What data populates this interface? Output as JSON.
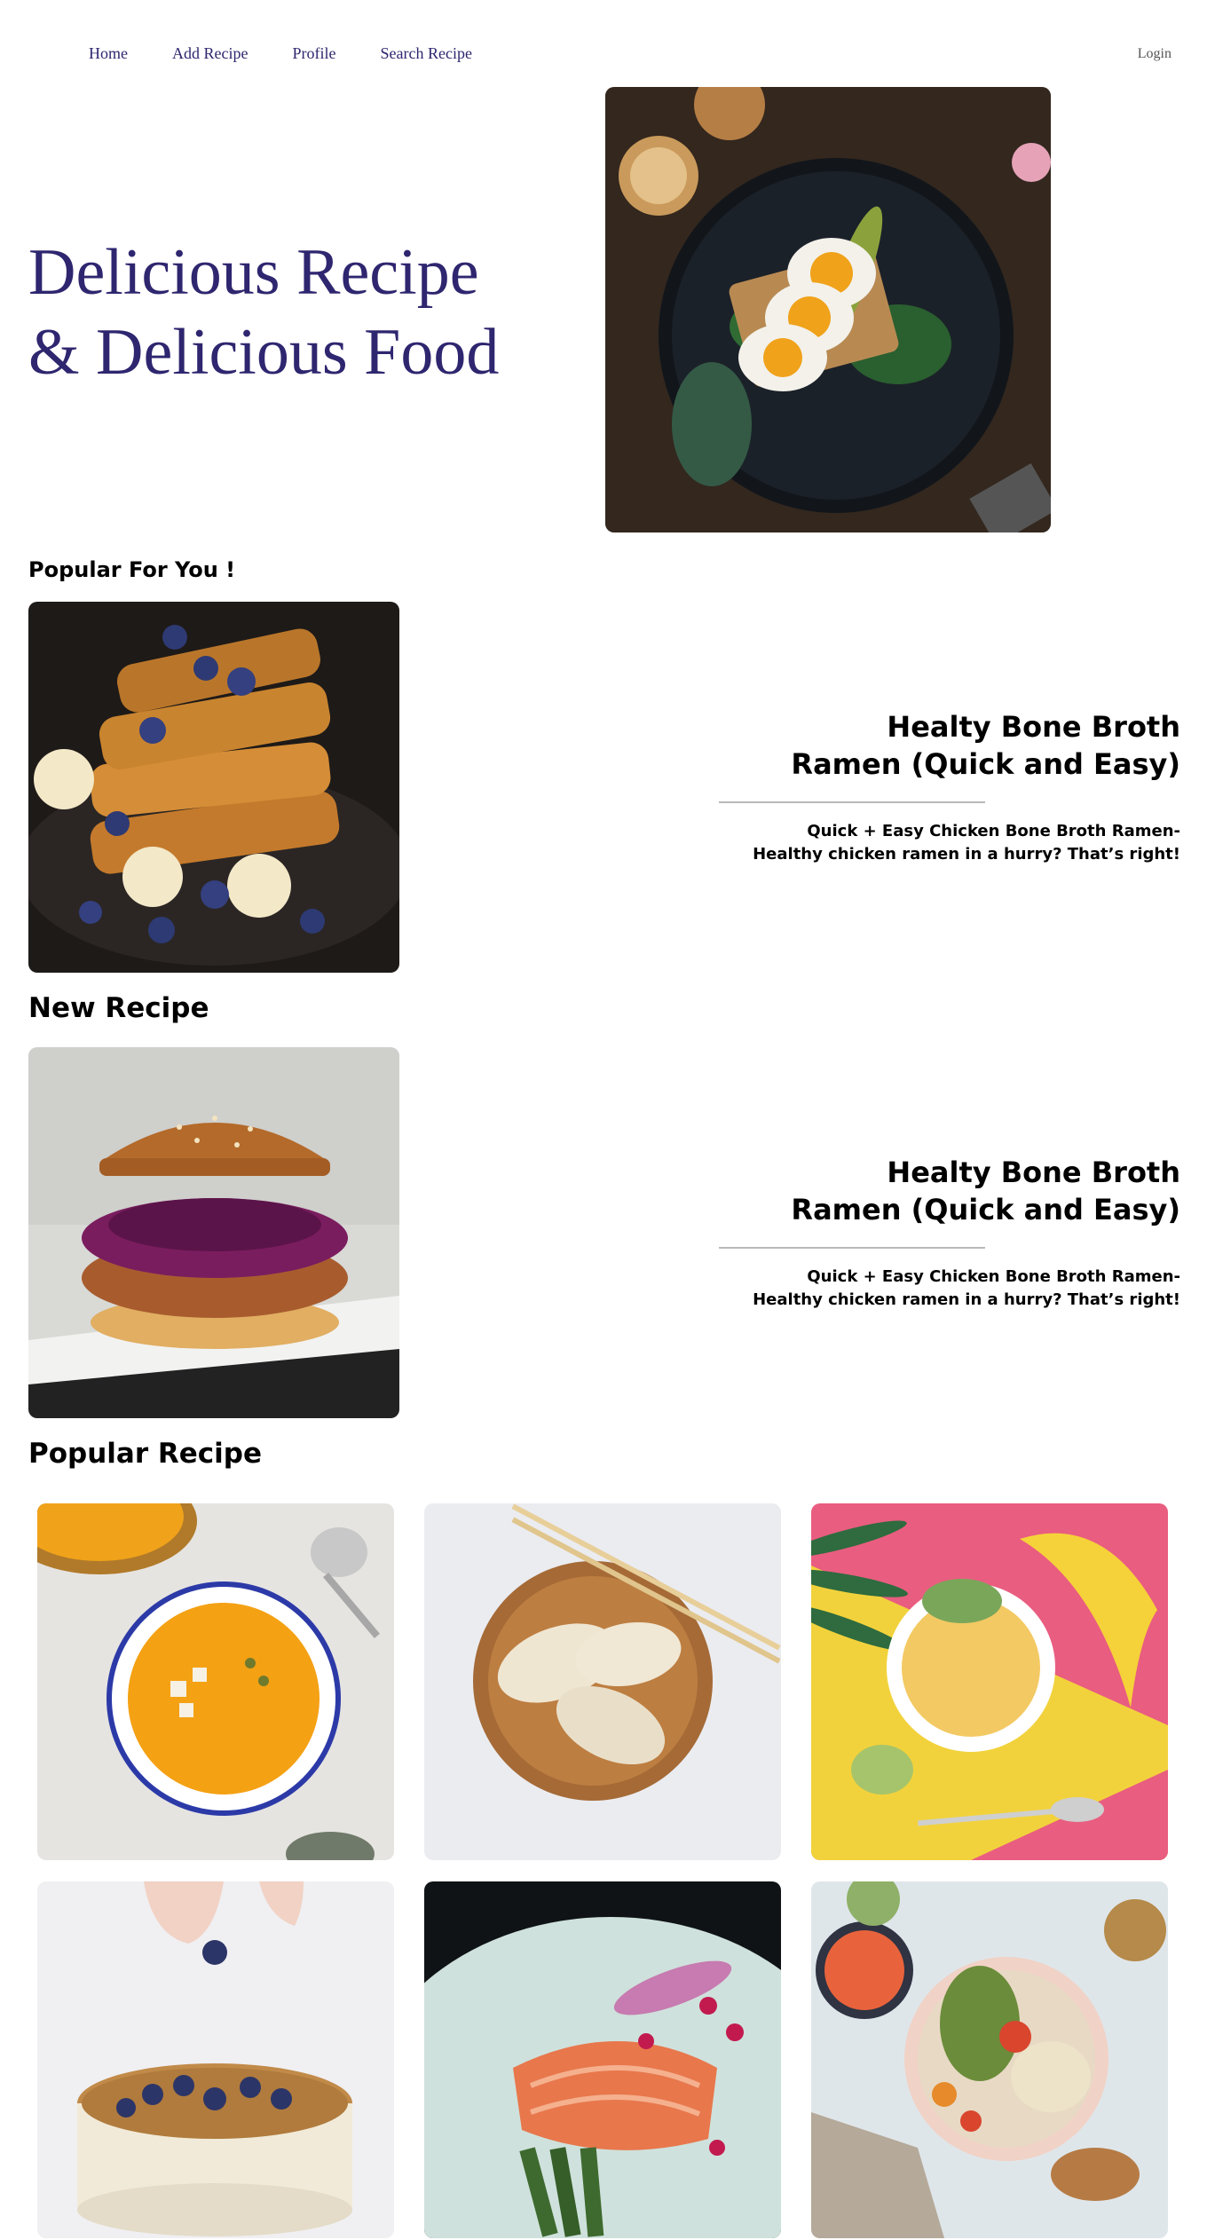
{
  "nav": {
    "items": [
      "Home",
      "Add Recipe",
      "Profile",
      "Search Recipe"
    ],
    "login": "Login"
  },
  "hero": {
    "title_line1": "Delicious Recipe",
    "title_line2": "& Delicious Food"
  },
  "sections": {
    "popular_for_you": "Popular For You !",
    "new_recipe": "New Recipe",
    "popular_recipe": "Popular Recipe"
  },
  "features": [
    {
      "title_line1": "Healty Bone Broth",
      "title_line2": "Ramen (Quick and Easy)",
      "desc_line1": "Quick + Easy Chicken Bone Broth Ramen-",
      "desc_line2": "Healthy chicken ramen in a hurry? That’s right!"
    },
    {
      "title_line1": "Healty Bone Broth",
      "title_line2": "Ramen (Quick and Easy)",
      "desc_line1": "Quick + Easy Chicken Bone Broth Ramen-",
      "desc_line2": "Healthy chicken ramen in a hurry? That’s right!"
    }
  ],
  "colors": {
    "brand": "#2e266f",
    "divider": "#b9b9b9"
  }
}
